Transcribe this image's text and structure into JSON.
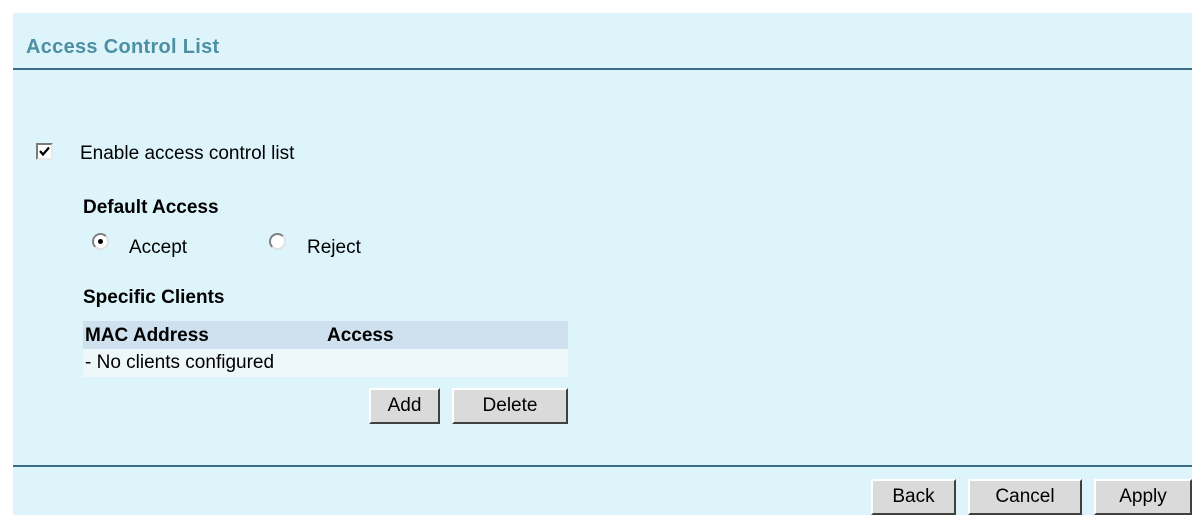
{
  "header": {
    "title": "Access Control List"
  },
  "acl": {
    "enable_label": "Enable access control list",
    "enabled": true,
    "default_access": {
      "heading": "Default Access",
      "options": [
        {
          "label": "Accept",
          "selected": true
        },
        {
          "label": "Reject",
          "selected": false
        }
      ]
    },
    "specific_clients": {
      "heading": "Specific Clients",
      "columns": [
        "MAC Address",
        "Access"
      ],
      "empty_text": "- No clients configured",
      "add_label": "Add",
      "delete_label": "Delete"
    }
  },
  "footer": {
    "back_label": "Back",
    "cancel_label": "Cancel",
    "apply_label": "Apply"
  },
  "colors": {
    "panel_bg": "#ddf4fb",
    "title": "#4d8fa3",
    "rule": "#3d6b8a",
    "table_header_bg": "#cfe1ee",
    "table_row_bg": "#eef8fb"
  },
  "icons": {
    "checkbox": "check-icon",
    "radio": "radio-dot-icon"
  }
}
